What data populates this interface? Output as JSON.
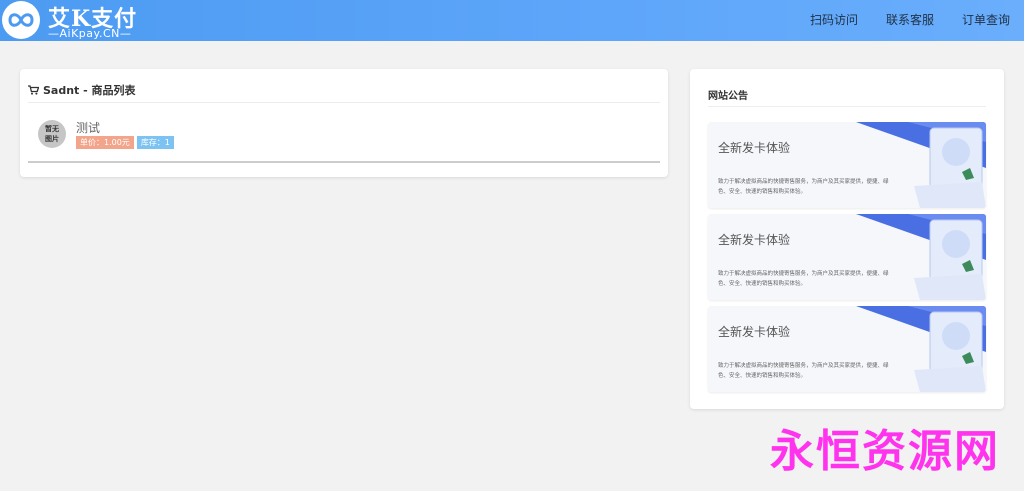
{
  "brand": {
    "logo_icon": "infinity-logo",
    "title": "艾K支付",
    "subtitle": "—AiKpay.CN—"
  },
  "nav": [
    {
      "label": "扫码访问"
    },
    {
      "label": "联系客服"
    },
    {
      "label": "订单查询"
    }
  ],
  "list": {
    "icon": "shopping-cart-icon",
    "title": "Sadnt - 商品列表",
    "items": [
      {
        "thumb_line1": "暂无",
        "thumb_line2": "图片",
        "name": "测试",
        "price_tag": "单价：1.00元",
        "stock_tag": "库存：1"
      }
    ]
  },
  "notice": {
    "title": "网站公告",
    "banners": [
      {
        "title": "全新发卡体验",
        "desc": "致力于解决虚拟商品的快捷寄售服务，为商户及其买家提供，便捷、绿色、安全、快速的销售和购买体验。"
      },
      {
        "title": "全新发卡体验",
        "desc": "致力于解决虚拟商品的快捷寄售服务，为商户及其买家提供，便捷、绿色、安全、快速的销售和购买体验。"
      },
      {
        "title": "全新发卡体验",
        "desc": "致力于解决虚拟商品的快捷寄售服务，为商户及其买家提供，便捷、绿色、安全、快速的销售和购买体验。"
      }
    ]
  },
  "watermark": "永恒资源网",
  "colors": {
    "header": "#5ea6fa",
    "price_tag": "#f3a58c",
    "stock_tag": "#7cc3f4",
    "watermark": "#ff33ee"
  }
}
